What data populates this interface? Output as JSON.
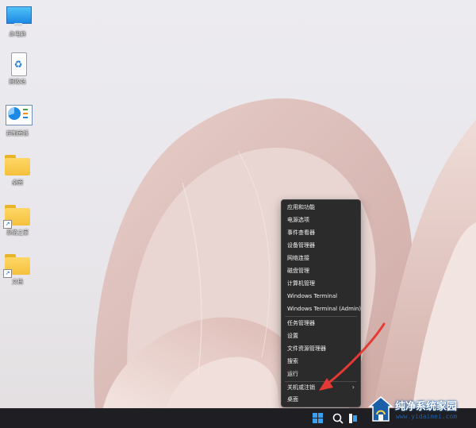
{
  "desktop": {
    "icons": [
      {
        "name": "desktop-icon-computer",
        "label": "此电脑"
      },
      {
        "name": "desktop-icon-recycle-bin",
        "label": "回收站"
      },
      {
        "name": "desktop-icon-control-panel",
        "label": "控制面板"
      },
      {
        "name": "desktop-icon-folder-1",
        "label": "桌面"
      },
      {
        "name": "desktop-icon-folder-2",
        "label": "系统之家"
      },
      {
        "name": "desktop-icon-folder-3",
        "label": "文档"
      }
    ]
  },
  "context_menu": {
    "items": [
      "应用和功能",
      "电源选项",
      "事件查看器",
      "设备管理器",
      "网络连接",
      "磁盘管理",
      "计算机管理",
      "Windows Terminal",
      "Windows Terminal (Admin)",
      "任务管理器",
      "设置",
      "文件资源管理器",
      "搜索",
      "运行",
      "关机或注销",
      "桌面"
    ],
    "submenu_chevron": "›"
  },
  "taskbar": {
    "icons": [
      "windows-start-icon",
      "search-icon",
      "task-view-icon"
    ]
  },
  "watermark": {
    "line1": "纯净系统家园",
    "line2": "www.yidaimei.com"
  },
  "colors": {
    "menu_bg": "#2b2b2b",
    "taskbar_bg": "#1f1f23",
    "annotation_arrow": "#e53935",
    "start_accent": "#3aa0f2"
  }
}
